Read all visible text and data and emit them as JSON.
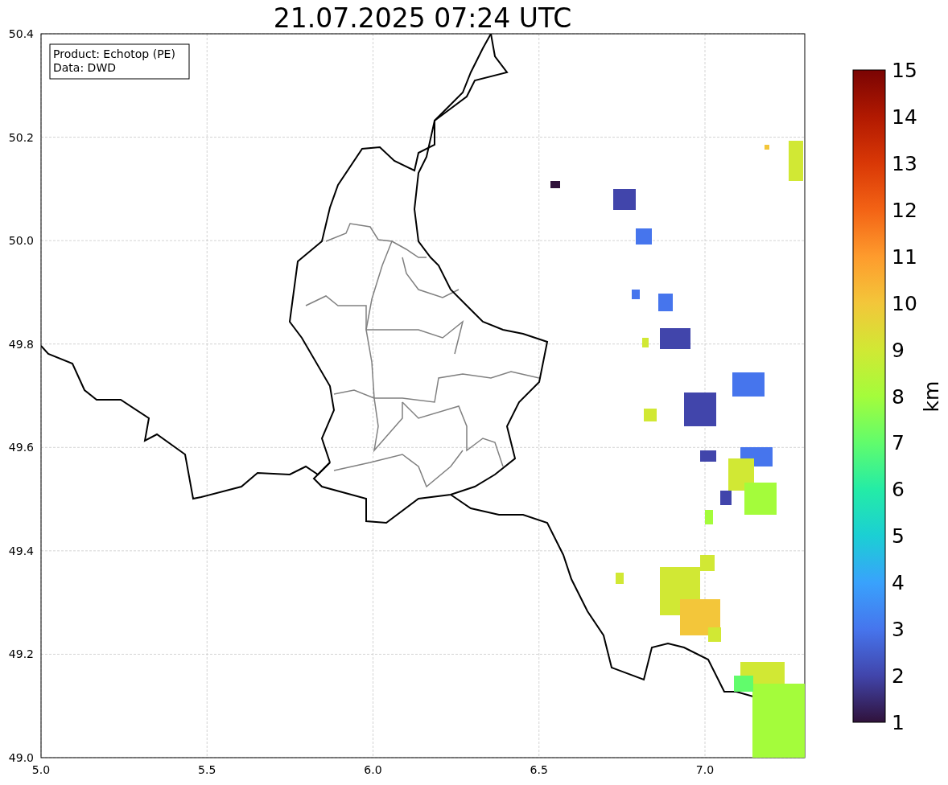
{
  "title": "21.07.2025 07:24 UTC",
  "legend": [
    "Product: Echotop (PE)",
    "Data: DWD"
  ],
  "x_axis": {
    "ticks": [
      "5.0",
      "5.5",
      "6.0",
      "6.5",
      "7.0"
    ]
  },
  "y_axis": {
    "ticks": [
      "50.4",
      "50.2",
      "50.0",
      "49.8",
      "49.6",
      "49.4",
      "49.2",
      "49.0"
    ]
  },
  "colorbar": {
    "label": "km",
    "ticks": [
      "15",
      "14",
      "13",
      "12",
      "11",
      "10",
      "9",
      "8",
      "7",
      "6",
      "5",
      "4",
      "3",
      "2",
      "1"
    ]
  }
}
